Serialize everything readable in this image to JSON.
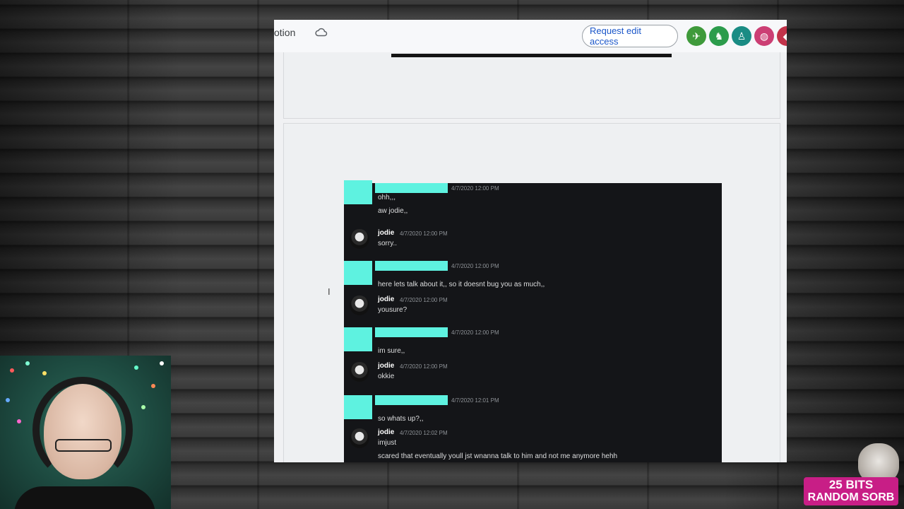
{
  "doc": {
    "title_fragment": "otion",
    "request_edit_label": "Request edit access",
    "collaborators": [
      {
        "icon": "airplane-icon",
        "color": "#3f9a3b",
        "glyph": "✈"
      },
      {
        "icon": "llama-icon",
        "color": "#2c9c4c",
        "glyph": "♞"
      },
      {
        "icon": "chair-icon",
        "color": "#1a8c84",
        "glyph": "♙"
      },
      {
        "icon": "elephant-icon",
        "color": "#cc3f74",
        "glyph": "◍"
      },
      {
        "icon": "animal-icon",
        "color": "#c2334a",
        "glyph": "◆"
      }
    ]
  },
  "chat": {
    "messages": [
      {
        "author": "",
        "redacted": true,
        "timestamp": "4/7/2020 12:00 PM",
        "lines": [
          "ohh,,,",
          "aw jodie,,"
        ]
      },
      {
        "author": "jodie",
        "redacted": false,
        "timestamp": "4/7/2020 12:00 PM",
        "lines": [
          "sorry.."
        ]
      },
      {
        "author": "",
        "redacted": true,
        "timestamp": "4/7/2020 12:00 PM",
        "lines": [
          "here lets talk about it,, so it doesnt bug you as much,,"
        ]
      },
      {
        "author": "jodie",
        "redacted": false,
        "timestamp": "4/7/2020 12:00 PM",
        "lines": [
          "yousure?"
        ]
      },
      {
        "author": "",
        "redacted": true,
        "timestamp": "4/7/2020 12:00 PM",
        "lines": [
          "im sure,,"
        ]
      },
      {
        "author": "jodie",
        "redacted": false,
        "timestamp": "4/7/2020 12:00 PM",
        "lines": [
          "okkie"
        ]
      },
      {
        "author": "",
        "redacted": true,
        "timestamp": "4/7/2020 12:01 PM",
        "lines": [
          "so whats up?,,"
        ]
      },
      {
        "author": "jodie",
        "redacted": false,
        "timestamp": "4/7/2020 12:02 PM",
        "lines": [
          "imjust",
          "scared that eventually youll jst wnanna talk to him and not me anymore hehh"
        ]
      }
    ]
  },
  "overlay": {
    "bits_line1": "25 BITS",
    "bits_line2": "RANDOM SORB"
  }
}
